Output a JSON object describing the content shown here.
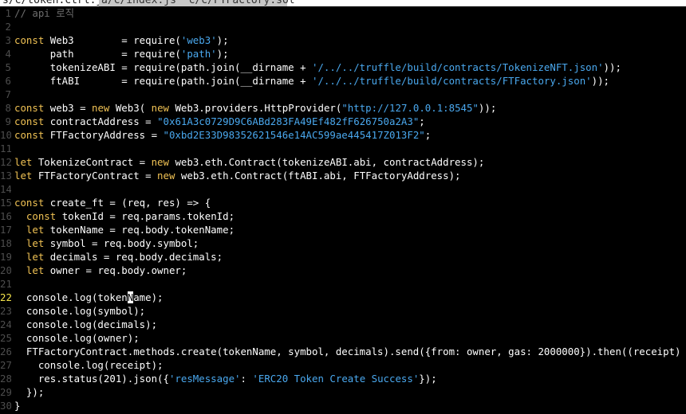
{
  "tabs": [
    {
      "label": "s/c/token.ctrl.js"
    },
    {
      "label": "a/c/index.js  c/c/FTFactory.sol"
    }
  ],
  "colors": {
    "background": "#000000",
    "keyword": "#f0c254",
    "string": "#4aa8ee",
    "comment": "#6d6d6d",
    "text": "#ffffff",
    "current_line_number": "#f3e34a"
  },
  "editor": {
    "current_line": 22,
    "lines": [
      {
        "n": "1",
        "t": [
          [
            "cmt",
            "// api 로직"
          ]
        ]
      },
      {
        "n": "2",
        "t": []
      },
      {
        "n": "3",
        "t": [
          [
            "kw",
            "const"
          ],
          [
            "p",
            " Web3        = require("
          ],
          [
            "str",
            "'web3'"
          ],
          [
            "p",
            ");"
          ]
        ]
      },
      {
        "n": "4",
        "t": [
          [
            "p",
            "      path        = require("
          ],
          [
            "str",
            "'path'"
          ],
          [
            "p",
            ");"
          ]
        ]
      },
      {
        "n": "5",
        "t": [
          [
            "p",
            "      tokenizeABI = require(path.join(__dirname + "
          ],
          [
            "str",
            "'/../../truffle/build/contracts/TokenizeNFT.json'"
          ],
          [
            "p",
            "));"
          ]
        ]
      },
      {
        "n": "6",
        "t": [
          [
            "p",
            "      ftABI       = require(path.join(__dirname + "
          ],
          [
            "str",
            "'/../../truffle/build/contracts/FTFactory.json'"
          ],
          [
            "p",
            "));"
          ]
        ]
      },
      {
        "n": "7",
        "t": []
      },
      {
        "n": "8",
        "t": [
          [
            "kw",
            "const"
          ],
          [
            "p",
            " web3 = "
          ],
          [
            "kw",
            "new"
          ],
          [
            "p",
            " Web3( "
          ],
          [
            "kw",
            "new"
          ],
          [
            "p",
            " Web3.providers.HttpProvider("
          ],
          [
            "str",
            "\"http://127.0.0.1:8545\""
          ],
          [
            "p",
            "));"
          ]
        ]
      },
      {
        "n": "9",
        "t": [
          [
            "kw",
            "const"
          ],
          [
            "p",
            " contractAddress = "
          ],
          [
            "str",
            "\"0x61A3c0729D9C6ABd283FA49Ef482fF626750a2A3\""
          ],
          [
            "p",
            ";"
          ]
        ]
      },
      {
        "n": "10",
        "t": [
          [
            "kw",
            "const"
          ],
          [
            "p",
            " FTFactoryAddress = "
          ],
          [
            "str",
            "\"0xbd2E33D98352621546e14AC599ae445417Z013F2\""
          ],
          [
            "p",
            ";"
          ]
        ]
      },
      {
        "n": "11",
        "t": []
      },
      {
        "n": "12",
        "t": [
          [
            "kw",
            "let"
          ],
          [
            "p",
            " TokenizeContract = "
          ],
          [
            "kw",
            "new"
          ],
          [
            "p",
            " web3.eth.Contract(tokenizeABI.abi, contractAddress);"
          ]
        ]
      },
      {
        "n": "13",
        "t": [
          [
            "kw",
            "let"
          ],
          [
            "p",
            " FTFactoryContract = "
          ],
          [
            "kw",
            "new"
          ],
          [
            "p",
            " web3.eth.Contract(ftABI.abi, FTFactoryAddress);"
          ]
        ]
      },
      {
        "n": "14",
        "t": []
      },
      {
        "n": "15",
        "t": [
          [
            "kw",
            "const"
          ],
          [
            "p",
            " create_ft = (req, res) => {"
          ]
        ]
      },
      {
        "n": "16",
        "t": [
          [
            "p",
            "  "
          ],
          [
            "kw",
            "const"
          ],
          [
            "p",
            " tokenId = req.params.tokenId;"
          ]
        ]
      },
      {
        "n": "17",
        "t": [
          [
            "p",
            "  "
          ],
          [
            "kw",
            "let"
          ],
          [
            "p",
            " tokenName = req.body.tokenName;"
          ]
        ]
      },
      {
        "n": "18",
        "t": [
          [
            "p",
            "  "
          ],
          [
            "kw",
            "let"
          ],
          [
            "p",
            " symbol = req.body.symbol;"
          ]
        ]
      },
      {
        "n": "19",
        "t": [
          [
            "p",
            "  "
          ],
          [
            "kw",
            "let"
          ],
          [
            "p",
            " decimals = req.body.decimals;"
          ]
        ]
      },
      {
        "n": "20",
        "t": [
          [
            "p",
            "  "
          ],
          [
            "kw",
            "let"
          ],
          [
            "p",
            " owner = req.body.owner;"
          ]
        ]
      },
      {
        "n": "21",
        "t": []
      },
      {
        "n": "22",
        "t": [
          [
            "p",
            "  console.log(token"
          ],
          [
            "cur",
            "N"
          ],
          [
            "p",
            "ame);"
          ]
        ]
      },
      {
        "n": "23",
        "t": [
          [
            "p",
            "  console.log(symbol);"
          ]
        ]
      },
      {
        "n": "24",
        "t": [
          [
            "p",
            "  console.log(decimals);"
          ]
        ]
      },
      {
        "n": "25",
        "t": [
          [
            "p",
            "  console.log(owner);"
          ]
        ]
      },
      {
        "n": "26",
        "t": [
          [
            "p",
            "  FTFactoryContract.methods.create(tokenName, symbol, decimals).send({from: owner, gas: 2000000}).then((receipt) => {"
          ]
        ]
      },
      {
        "n": "27",
        "t": [
          [
            "p",
            "    console.log(receipt);"
          ]
        ]
      },
      {
        "n": "28",
        "t": [
          [
            "p",
            "    res.status(201).json({"
          ],
          [
            "str",
            "'resMessage'"
          ],
          [
            "p",
            ": "
          ],
          [
            "str",
            "'ERC20 Token Create Success'"
          ],
          [
            "p",
            "});"
          ]
        ]
      },
      {
        "n": "29",
        "t": [
          [
            "p",
            "  });"
          ]
        ]
      },
      {
        "n": "30",
        "t": [
          [
            "p",
            "}"
          ]
        ]
      }
    ]
  }
}
